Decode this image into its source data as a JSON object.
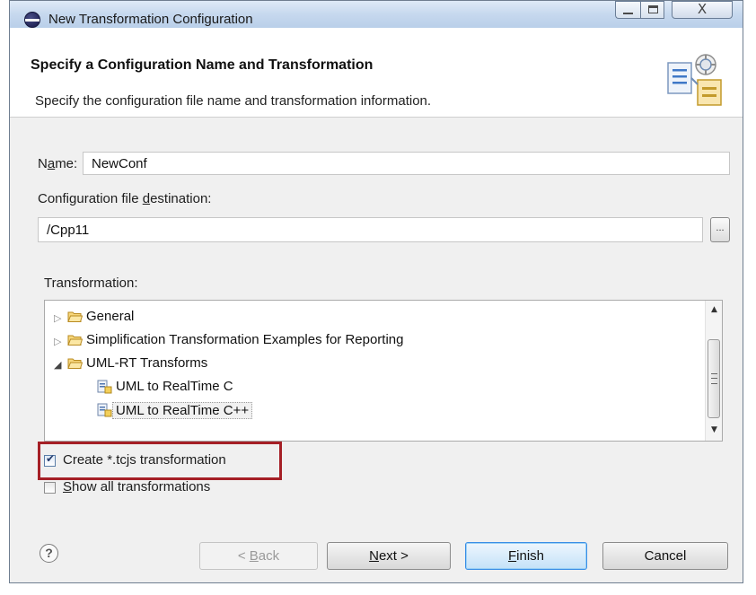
{
  "window": {
    "title": "New Transformation Configuration",
    "close_glyph": "X"
  },
  "header": {
    "title": "Specify a Configuration Name and Transformation",
    "description": "Specify the configuration file name and transformation information."
  },
  "form": {
    "name_label_pre": "N",
    "name_label_u": "a",
    "name_label_post": "me:",
    "name_value": "NewConf",
    "destination_label_pre": "Configuration file ",
    "destination_label_u": "d",
    "destination_label_post": "estination:",
    "destination_value": "/Cpp11",
    "browse_label": "...",
    "transformation_label": "Transformation:"
  },
  "tree": {
    "items": [
      {
        "label": "General",
        "expanded": false
      },
      {
        "label": "Simplification Transformation Examples for Reporting",
        "expanded": false
      },
      {
        "label": "UML-RT Transforms",
        "expanded": true
      },
      {
        "label": "UML to RealTime C"
      },
      {
        "label": "UML to RealTime C++",
        "selected": true
      }
    ],
    "twisty_collapsed": "▷",
    "twisty_expanded": "◢",
    "scroll_up": "▲",
    "scroll_down": "▼"
  },
  "options": {
    "create_tcjs": {
      "label": "Create *.tcjs transformation",
      "checked": true
    },
    "show_all_pre": "",
    "show_all_u": "S",
    "show_all_post": "how all transformations",
    "show_all_checked": false,
    "checkmark": "✔"
  },
  "buttons": {
    "help": "?",
    "back_pre": "< ",
    "back_u": "B",
    "back_post": "ack",
    "next_u": "N",
    "next_post": "ext >",
    "finish_u": "F",
    "finish_post": "inish",
    "cancel": "Cancel"
  },
  "colors": {
    "highlight_box": "#a51f26",
    "default_button_border": "#3a8ee6"
  }
}
